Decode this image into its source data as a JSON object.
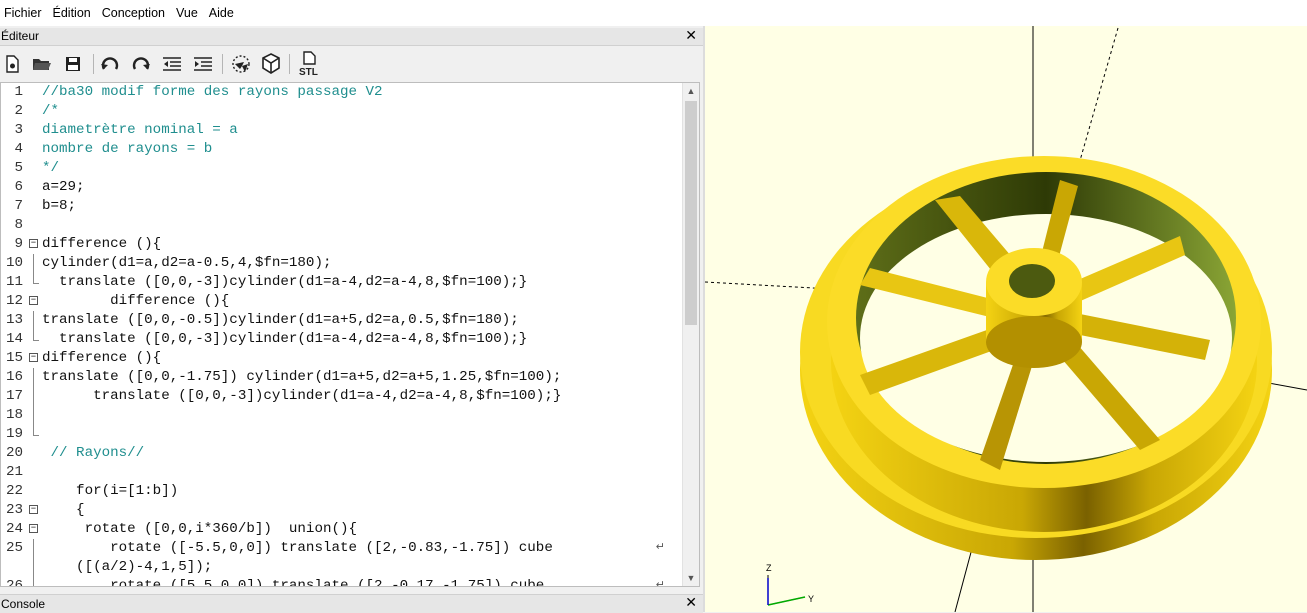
{
  "menu": [
    "Fichier",
    "Édition",
    "Conception",
    "Vue",
    "Aide"
  ],
  "editor": {
    "title": "Éditeur",
    "close": "✕",
    "lines": [
      {
        "n": "1",
        "text": "//ba30 modif forme des rayons passage V2",
        "fold": ""
      },
      {
        "n": "2",
        "text": "/*",
        "fold": ""
      },
      {
        "n": "3",
        "text": "diametrètre nominal = a",
        "fold": ""
      },
      {
        "n": "4",
        "text": "nombre de rayons = b",
        "fold": ""
      },
      {
        "n": "5",
        "text": "*/",
        "fold": ""
      },
      {
        "n": "6",
        "text": "a=29;",
        "fold": ""
      },
      {
        "n": "7",
        "text": "b=8;",
        "fold": ""
      },
      {
        "n": "8",
        "text": "",
        "fold": ""
      },
      {
        "n": "9",
        "text": "difference (){",
        "fold": "start"
      },
      {
        "n": "10",
        "text": "cylinder(d1=a,d2=a-0.5,4,$fn=180);",
        "fold": "line"
      },
      {
        "n": "11",
        "text": "  translate ([0,0,-3])cylinder(d1=a-4,d2=a-4,8,$fn=100);}",
        "fold": "end"
      },
      {
        "n": "12",
        "text": "        difference (){",
        "fold": "start"
      },
      {
        "n": "13",
        "text": "translate ([0,0,-0.5])cylinder(d1=a+5,d2=a,0.5,$fn=180);",
        "fold": "line"
      },
      {
        "n": "14",
        "text": "  translate ([0,0,-3])cylinder(d1=a-4,d2=a-4,8,$fn=100);}",
        "fold": "end"
      },
      {
        "n": "15",
        "text": "difference (){",
        "fold": "start"
      },
      {
        "n": "16",
        "text": "translate ([0,0,-1.75]) cylinder(d1=a+5,d2=a+5,1.25,$fn=100);",
        "fold": "line"
      },
      {
        "n": "17",
        "text": "      translate ([0,0,-3])cylinder(d1=a-4,d2=a-4,8,$fn=100);}",
        "fold": "line"
      },
      {
        "n": "18",
        "text": "",
        "fold": "line"
      },
      {
        "n": "19",
        "text": "",
        "fold": "end"
      },
      {
        "n": "20",
        "text": " // Rayons//",
        "fold": ""
      },
      {
        "n": "21",
        "text": "",
        "fold": ""
      },
      {
        "n": "22",
        "text": "    for(i=[1:b])",
        "fold": ""
      },
      {
        "n": "23",
        "text": "    {",
        "fold": "start"
      },
      {
        "n": "24",
        "text": "     rotate ([0,0,i*360/b])  union(){",
        "fold": "start2"
      },
      {
        "n": "25",
        "text": "        rotate ([-5.5,0,0]) translate ([2,-0.83,-1.75]) cube",
        "fold": "line"
      },
      {
        "n": "",
        "text": "    ([(a/2)-4,1,5]);",
        "fold": "line"
      },
      {
        "n": "26",
        "text": "        rotate ([5.5,0,0]) translate ([2,-0.17,-1.75]) cube",
        "fold": "line"
      }
    ]
  },
  "toolbar": {
    "icons": [
      "new-file-icon",
      "open-file-icon",
      "save-icon",
      "undo-icon",
      "redo-icon",
      "unindent-icon",
      "indent-icon",
      "preview-icon",
      "render-icon",
      "export-stl-icon"
    ],
    "stl_label": "STL"
  },
  "console": {
    "title": "Console",
    "close": "✕"
  },
  "viewport": {
    "background": "#ffffe5",
    "model_color": "#f5d61c",
    "axis_labels": {
      "z": "Z",
      "y": "Y"
    }
  }
}
